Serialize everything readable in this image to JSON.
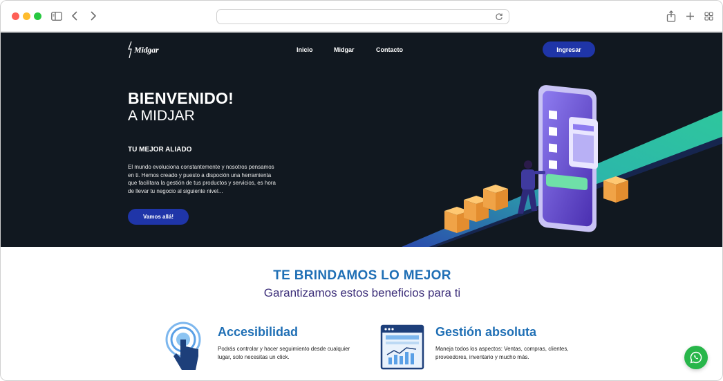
{
  "browser": {
    "url": "",
    "icons": {
      "sidebar": "sidebar-icon",
      "back": "chevron-left-icon",
      "forward": "chevron-right-icon",
      "reload": "reload-icon",
      "share": "share-icon",
      "new_tab": "plus-icon",
      "tab_overview": "grid-icon"
    }
  },
  "header": {
    "logo_text": "Midgar",
    "nav": [
      "Inicio",
      "Midgar",
      "Contacto"
    ],
    "login_label": "Ingresar"
  },
  "hero": {
    "title": "BIENVENIDO!",
    "subtitle": "A MIDJAR",
    "tagline": "TU MEJOR ALIADO",
    "description": "El mundo evoluciona constantemente y nosotros pensamos en ti. Hemos creado y puesto a dispoción una herramienta que facilitara la gestión de tus productos y servicios, es hora de llevar tu negocio al siguiente nivel...",
    "cta_label": "Vamos allá!"
  },
  "benefits": {
    "title": "TE BRINDAMOS LO MEJOR",
    "subtitle": "Garantizamos estos beneficios para ti",
    "items": [
      {
        "icon": "touch-icon",
        "title": "Accesibilidad",
        "text": "Podrás controlar y hacer seguimiento desde cualquier lugar, solo necesitas un click."
      },
      {
        "icon": "dashboard-icon",
        "title": "Gestión absoluta",
        "text": "Maneja todos los aspectos: Ventas, compras, clientes, proveedores, inventario y mucho más."
      }
    ]
  },
  "whatsapp": {
    "icon": "whatsapp-icon"
  },
  "colors": {
    "hero_bg": "#111820",
    "accent": "#1f35a8",
    "title_blue": "#1f6fb5",
    "subtitle_purple": "#3d2f7a",
    "whatsapp_green": "#28b64a"
  }
}
